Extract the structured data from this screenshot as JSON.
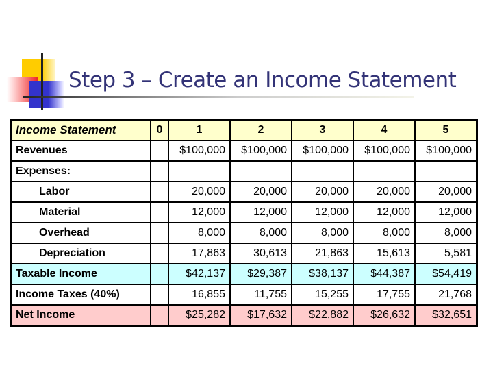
{
  "slide": {
    "title": "Step 3 – Create an Income Statement"
  },
  "table": {
    "header": {
      "label": "Income Statement",
      "years": [
        "0",
        "1",
        "2",
        "3",
        "4",
        "5"
      ]
    },
    "rows": [
      {
        "label": "Revenues",
        "values": [
          "",
          "$100,000",
          "$100,000",
          "$100,000",
          "$100,000",
          "$100,000"
        ]
      },
      {
        "label": "Expenses:",
        "values": [
          "",
          "",
          "",
          "",
          "",
          ""
        ]
      },
      {
        "label": "Labor",
        "values": [
          "",
          "20,000",
          "20,000",
          "20,000",
          "20,000",
          "20,000"
        ]
      },
      {
        "label": "Material",
        "values": [
          "",
          "12,000",
          "12,000",
          "12,000",
          "12,000",
          "12,000"
        ]
      },
      {
        "label": "Overhead",
        "values": [
          "",
          "8,000",
          "8,000",
          "8,000",
          "8,000",
          "8,000"
        ]
      },
      {
        "label": "Depreciation",
        "values": [
          "",
          "17,863",
          "30,613",
          "21,863",
          "15,613",
          "5,581"
        ]
      },
      {
        "label": "Taxable Income",
        "values": [
          "",
          "$42,137",
          "$29,387",
          "$38,137",
          "$44,387",
          "$54,419"
        ]
      },
      {
        "label": "Income Taxes (40%)",
        "values": [
          "",
          "16,855",
          "11,755",
          "15,255",
          "17,755",
          "21,768"
        ]
      },
      {
        "label": "Net Income",
        "values": [
          "",
          "$25,282",
          "$17,632",
          "$22,882",
          "$26,632",
          "$32,651"
        ]
      }
    ],
    "colors": {
      "header_bg": "#ffffcc",
      "taxable_bg": "#ccffff",
      "net_bg": "#ffcccc",
      "title_color": "#333377"
    }
  }
}
